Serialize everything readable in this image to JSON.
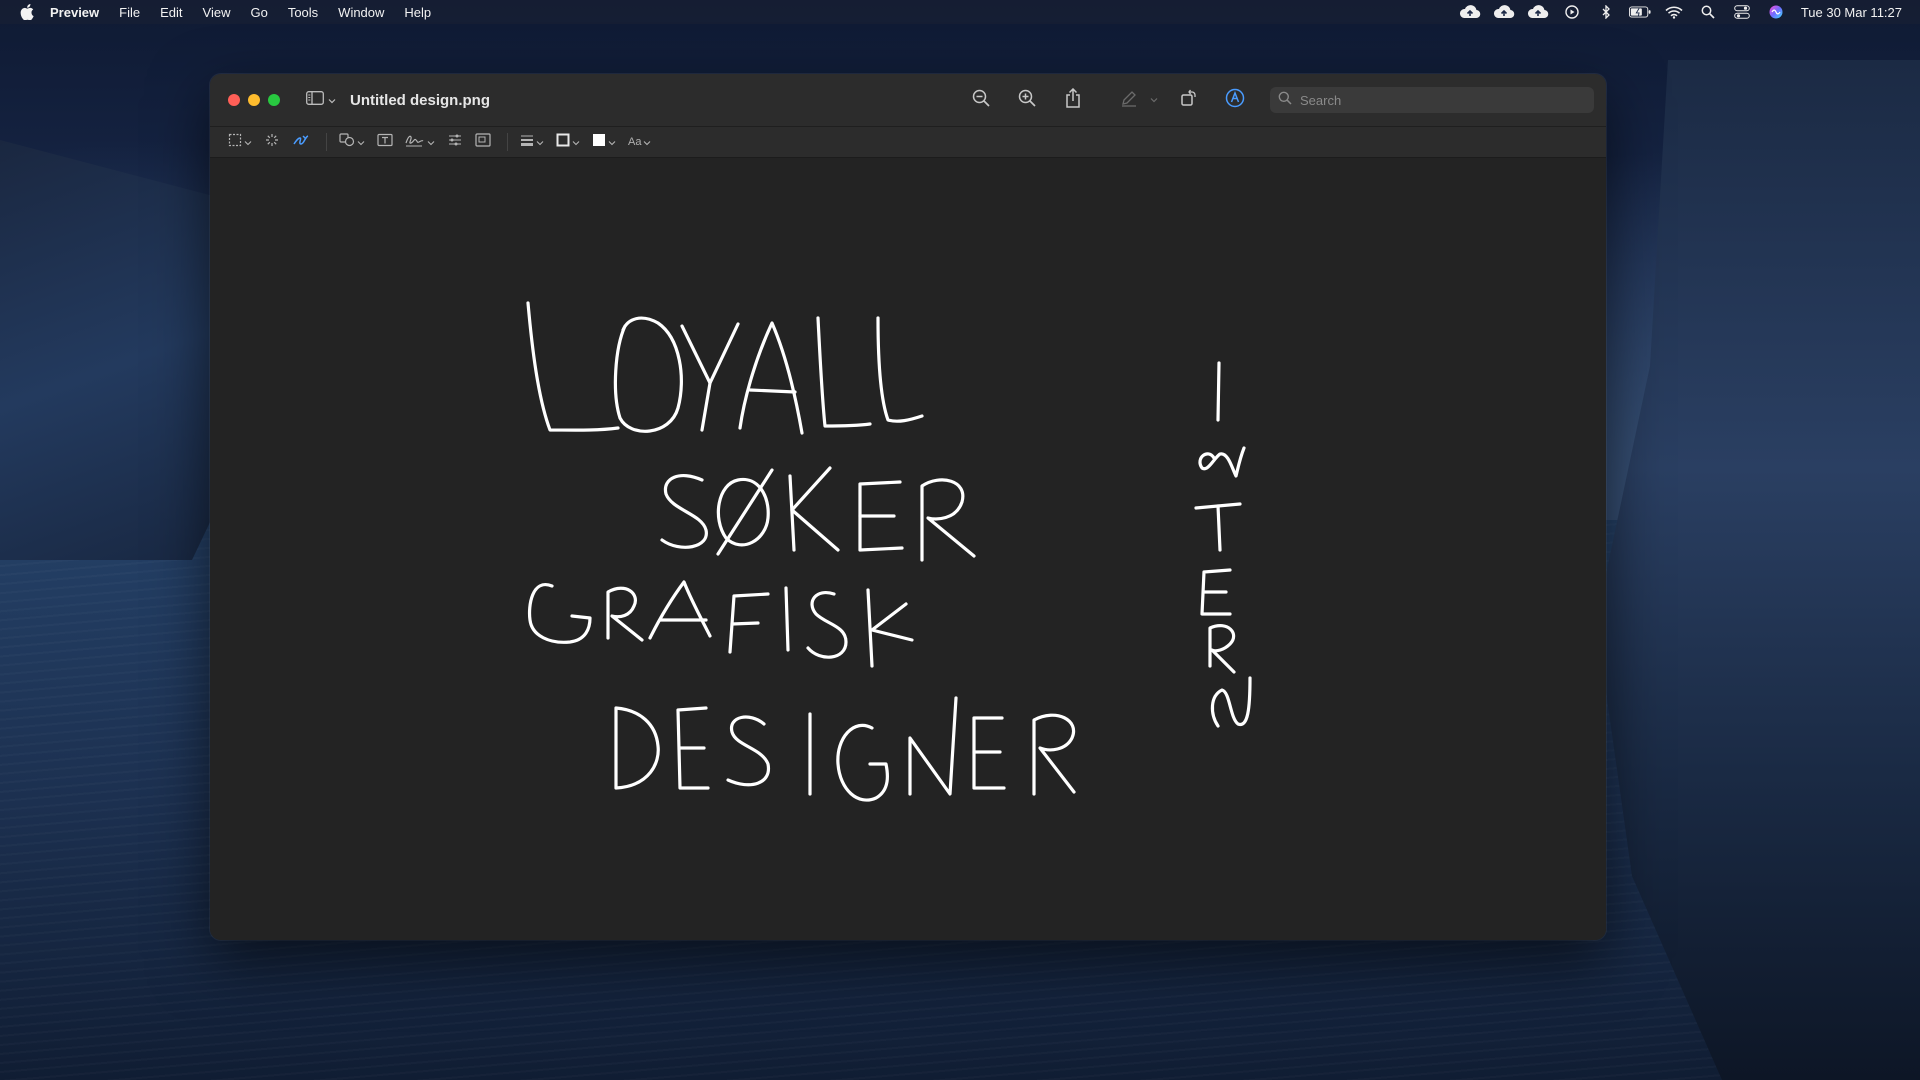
{
  "menubar": {
    "app_name": "Preview",
    "items": [
      "File",
      "Edit",
      "View",
      "Go",
      "Tools",
      "Window",
      "Help"
    ],
    "clock": "Tue 30 Mar  11:27",
    "status_icons": [
      "icloud-upload-icon",
      "icloud-upload-icon",
      "icloud-upload-icon",
      "play-circle-icon",
      "bluetooth-icon",
      "battery-icon",
      "wifi-icon",
      "spotlight-search-icon",
      "control-center-icon",
      "siri-icon"
    ]
  },
  "window": {
    "title": "Untitled design.png",
    "search_placeholder": "Search",
    "toolbar": [
      "zoom-out-icon",
      "zoom-in-icon",
      "share-icon",
      "highlight-pen-icon",
      "rotate-icon",
      "markup-icon"
    ],
    "markup_tools": [
      "rect-select-icon",
      "instant-alpha-icon",
      "sketch-icon",
      "shapes-icon",
      "text-box-icon",
      "signature-icon",
      "adjust-color-icon",
      "adjust-size-icon",
      "shape-style-icon",
      "border-color-icon",
      "fill-color-icon",
      "text-style-icon"
    ],
    "text_style_label": "Aa"
  },
  "colors": {
    "canvas": "#232323",
    "window": "#262626",
    "accent": "#4a9cff"
  }
}
